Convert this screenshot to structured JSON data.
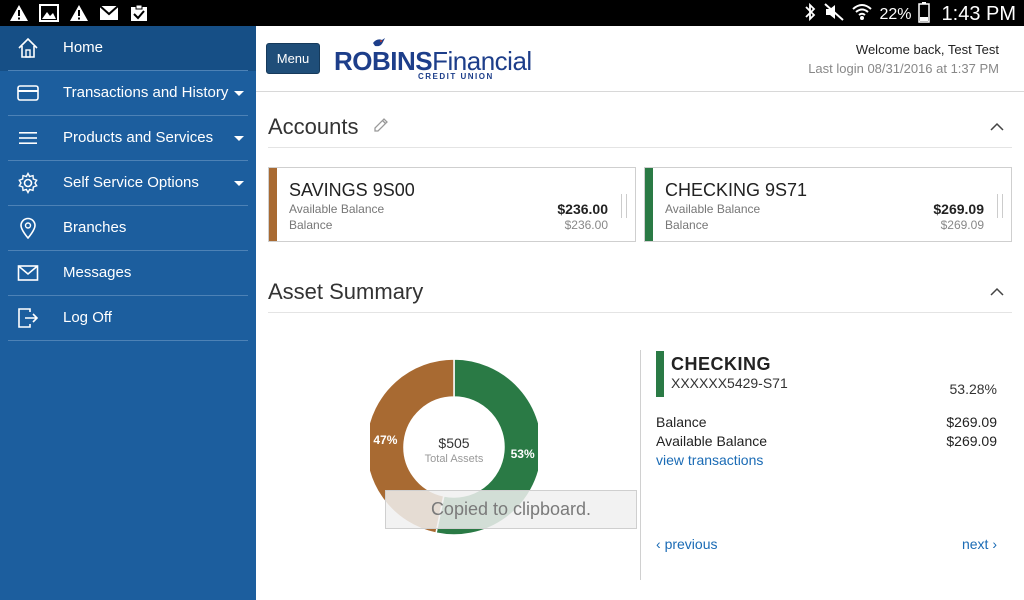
{
  "status_bar": {
    "battery": "22%",
    "time": "1:43 PM",
    "left_icons": [
      "warning-icon",
      "image-icon",
      "warning-icon",
      "gmail-icon",
      "clipboard-check-icon"
    ],
    "right_icons": [
      "bluetooth-icon",
      "mute-icon",
      "wifi-icon",
      "battery-icon"
    ]
  },
  "sidebar": {
    "items": [
      {
        "label": "Home",
        "icon": "home-icon",
        "has_dropdown": false
      },
      {
        "label": "Transactions and History",
        "icon": "card-icon",
        "has_dropdown": true
      },
      {
        "label": "Products and Services",
        "icon": "menu-icon",
        "has_dropdown": true
      },
      {
        "label": "Self Service Options",
        "icon": "gear-icon",
        "has_dropdown": true
      },
      {
        "label": "Branches",
        "icon": "location-pin-icon",
        "has_dropdown": false
      },
      {
        "label": "Messages",
        "icon": "envelope-icon",
        "has_dropdown": false
      },
      {
        "label": "Log Off",
        "icon": "logout-icon",
        "has_dropdown": false
      }
    ]
  },
  "header": {
    "menu_label": "Menu",
    "logo_robins": "ROBINS",
    "logo_financial": "Financial",
    "logo_sub": "CREDIT UNION",
    "welcome": "Welcome back, Test Test",
    "last_login": "Last login 08/31/2016 at 1:37 PM"
  },
  "accounts": {
    "title": "Accounts",
    "cards": [
      {
        "name": "SAVINGS  9S00",
        "label1": "Available Balance",
        "value1": "$236.00",
        "label2": "Balance",
        "value2": "$236.00",
        "color": "#a86a32"
      },
      {
        "name": "CHECKING  9S71",
        "label1": "Available Balance",
        "value1": "$269.09",
        "label2": "Balance",
        "value2": "$269.09",
        "color": "#2a7a45"
      }
    ]
  },
  "asset_summary": {
    "title": "Asset Summary",
    "total_amount": "$505",
    "total_label": "Total Assets",
    "slices": [
      {
        "label": "53%",
        "value": 53.28,
        "color": "#2a7a45"
      },
      {
        "label": "47%",
        "value": 46.72,
        "color": "#a86a32"
      }
    ],
    "detail": {
      "name": "CHECKING",
      "number": "XXXXXX5429-S71",
      "percent": "53.28%",
      "balance_label": "Balance",
      "balance_value": "$269.09",
      "available_label": "Available Balance",
      "available_value": "$269.09",
      "view_link": "view transactions",
      "previous": "previous",
      "next": "next"
    }
  },
  "toast": "Copied to clipboard."
}
